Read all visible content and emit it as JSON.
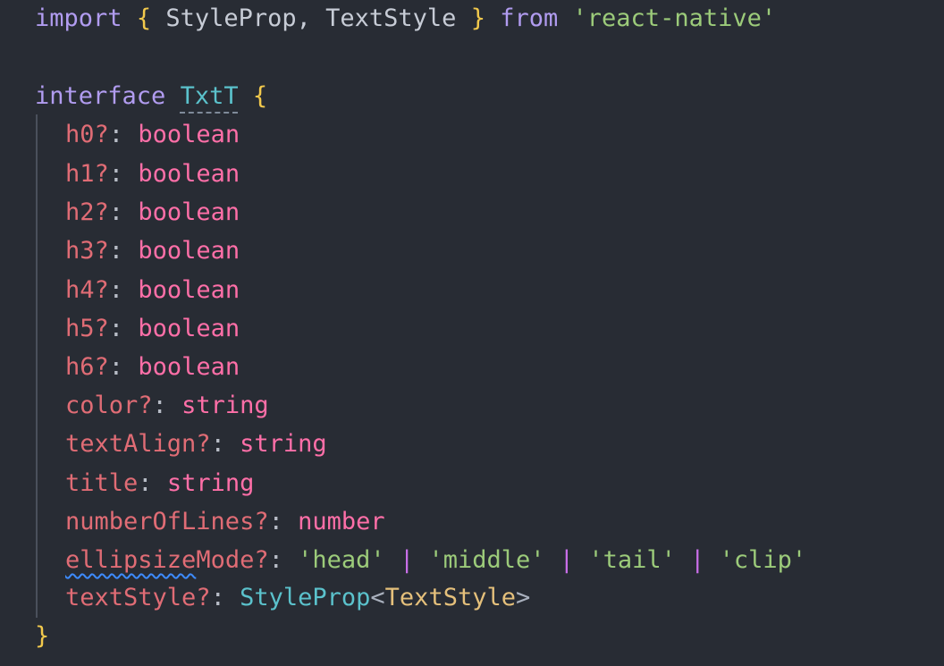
{
  "code": {
    "import_line": {
      "kw_import": "import",
      "brace_open": "{",
      "names": " StyleProp, TextStyle ",
      "brace_close": "}",
      "kw_from": "from",
      "module": "'react-native'"
    },
    "interface_line": {
      "kw_interface": "interface",
      "name": "TxtT",
      "brace_open": "{"
    },
    "props": [
      {
        "name": "h0?",
        "type": "boolean"
      },
      {
        "name": "h1?",
        "type": "boolean"
      },
      {
        "name": "h2?",
        "type": "boolean"
      },
      {
        "name": "h3?",
        "type": "boolean"
      },
      {
        "name": "h4?",
        "type": "boolean"
      },
      {
        "name": "h5?",
        "type": "boolean"
      },
      {
        "name": "h6?",
        "type": "boolean"
      },
      {
        "name": "color?",
        "type": "string"
      },
      {
        "name": "textAlign?",
        "type": "string"
      },
      {
        "name": "title",
        "type": "string"
      },
      {
        "name": "numberOfLines?",
        "type": "number"
      }
    ],
    "ellipsize_line": {
      "name_squiggled": "ellipsize",
      "name_rest": "Mode?",
      "values": [
        "'head'",
        "'middle'",
        "'tail'",
        "'clip'"
      ],
      "pipe": "|"
    },
    "textstyle_line": {
      "name": "textStyle?",
      "type_ref": "StyleProp",
      "angle_open": "<",
      "type_arg": "TextStyle",
      "angle_close": ">"
    },
    "closing_brace": "}",
    "colon": ":"
  },
  "colors": {
    "background": "#282c34",
    "keyword": "#b19cf0",
    "brace": "#f2c94c",
    "string": "#9ccb7a",
    "property": "#e06c75",
    "type": "#ff6fa8",
    "type_ref": "#5bc2cc"
  }
}
